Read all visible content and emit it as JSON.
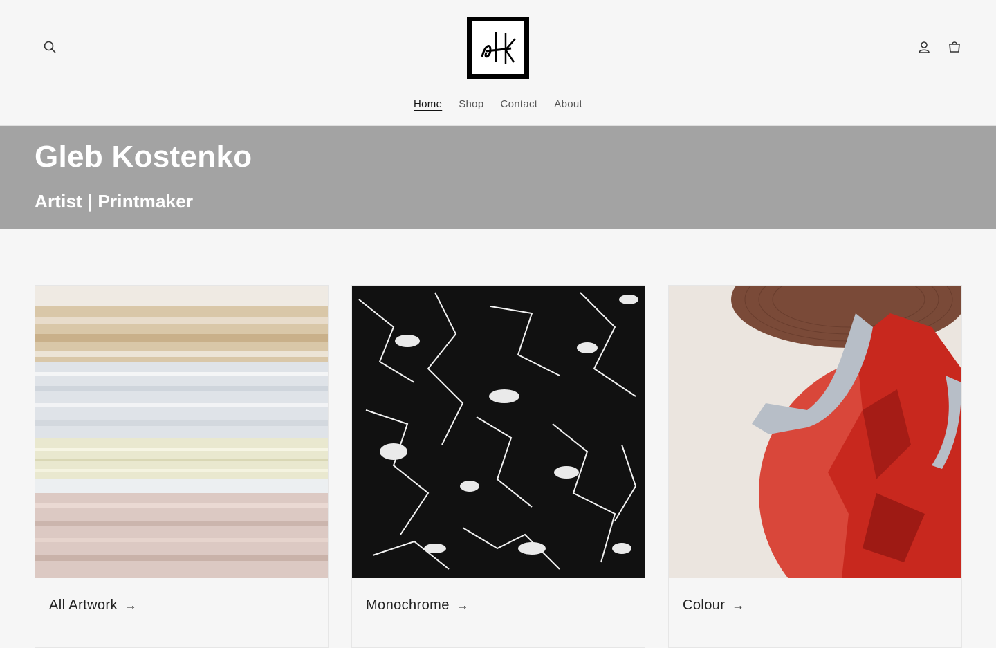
{
  "header": {
    "search_icon": "search-icon",
    "account_icon": "account-icon",
    "cart_icon": "cart-icon",
    "logo_icon": "gk-monogram-logo"
  },
  "nav": {
    "items": [
      {
        "label": "Home",
        "active": true
      },
      {
        "label": "Shop",
        "active": false
      },
      {
        "label": "Contact",
        "active": false
      },
      {
        "label": "About",
        "active": false
      }
    ]
  },
  "banner": {
    "title": "Gleb Kostenko",
    "subtitle": "Artist | Printmaker",
    "background": "#a3a3a3"
  },
  "collections": [
    {
      "label": "All Artwork",
      "arrow": "→"
    },
    {
      "label": "Monochrome",
      "arrow": "→"
    },
    {
      "label": "Colour",
      "arrow": "→"
    }
  ]
}
